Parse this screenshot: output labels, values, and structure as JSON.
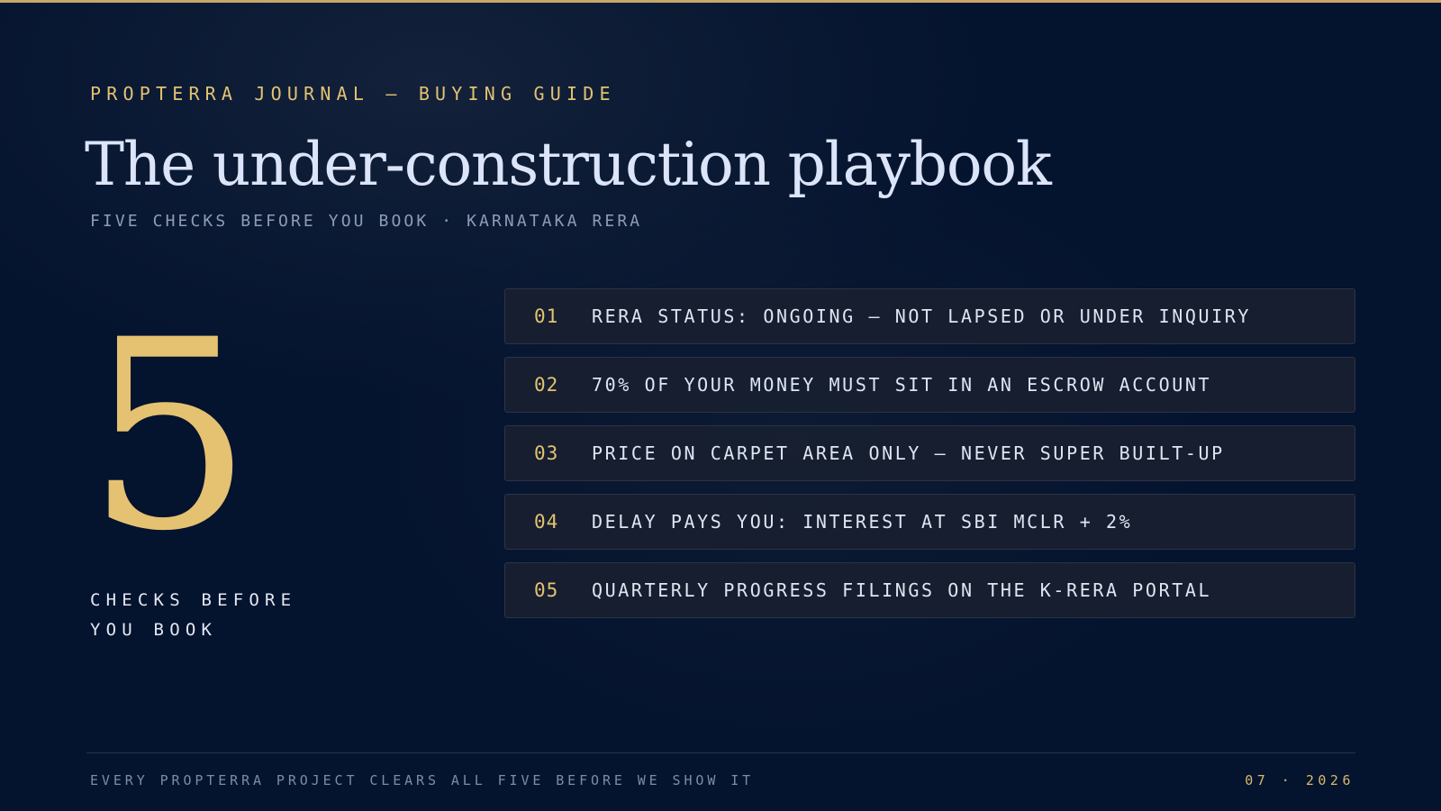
{
  "header": {
    "kicker": "PROPTERRA JOURNAL — BUYING GUIDE",
    "title": "The under-construction playbook",
    "subtitle": "FIVE CHECKS BEFORE YOU BOOK · KARNATAKA RERA"
  },
  "highlight": {
    "number": "5",
    "caption_line1": "CHECKS BEFORE",
    "caption_line2": "YOU BOOK"
  },
  "checks": [
    {
      "num": "01",
      "text": "RERA STATUS: ONGOING — NOT LAPSED OR UNDER INQUIRY"
    },
    {
      "num": "02",
      "text": "70% OF YOUR MONEY MUST SIT IN AN ESCROW ACCOUNT"
    },
    {
      "num": "03",
      "text": "PRICE ON CARPET AREA ONLY — NEVER SUPER BUILT-UP"
    },
    {
      "num": "04",
      "text": "DELAY PAYS YOU: INTEREST AT SBI MCLR + 2%"
    },
    {
      "num": "05",
      "text": "QUARTERLY PROGRESS FILINGS ON THE K-RERA PORTAL"
    }
  ],
  "footer": {
    "note": "EVERY PROPTERRA PROJECT CLEARS ALL FIVE BEFORE WE SHOW IT",
    "date": "07 · 2026"
  },
  "colors": {
    "accent_gold": "#e4c272",
    "background": "#04132e",
    "title_text": "#dbe4f8"
  }
}
